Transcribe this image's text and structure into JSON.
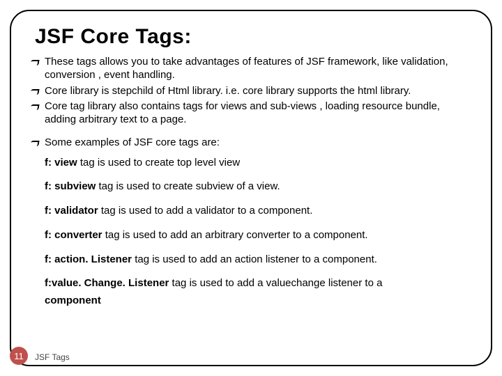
{
  "title": "JSF Core Tags:",
  "bullets": [
    "These tags allows you to take advantages of features of JSF framework, like validation, conversion , event handling.",
    "Core library is stepchild of Html library. i.e. core library supports the html library.",
    "Core tag library also contains tags for views and sub-views , loading resource bundle, adding arbitrary text to a page.",
    "Some examples of JSF core tags are:"
  ],
  "examples": [
    {
      "bold": "f: view  ",
      "rest": "tag is used to create top level view"
    },
    {
      "bold": "f: subview ",
      "rest": "tag is used to create subview of  a view."
    },
    {
      "bold": "f: validator ",
      "rest": "tag is used to add a validator to a component."
    },
    {
      "bold": "f: converter ",
      "rest": "tag is used to add an arbitrary converter to a component."
    },
    {
      "bold": "f: action. Listener ",
      "rest": "tag is used to add an action listener to a component."
    },
    {
      "bold": "f:value. Change. Listener ",
      "rest": "tag is used to add a valuechange listener to a"
    },
    {
      "bold": "component",
      "rest": ""
    }
  ],
  "page_number": "11",
  "footer": "JSF Tags"
}
